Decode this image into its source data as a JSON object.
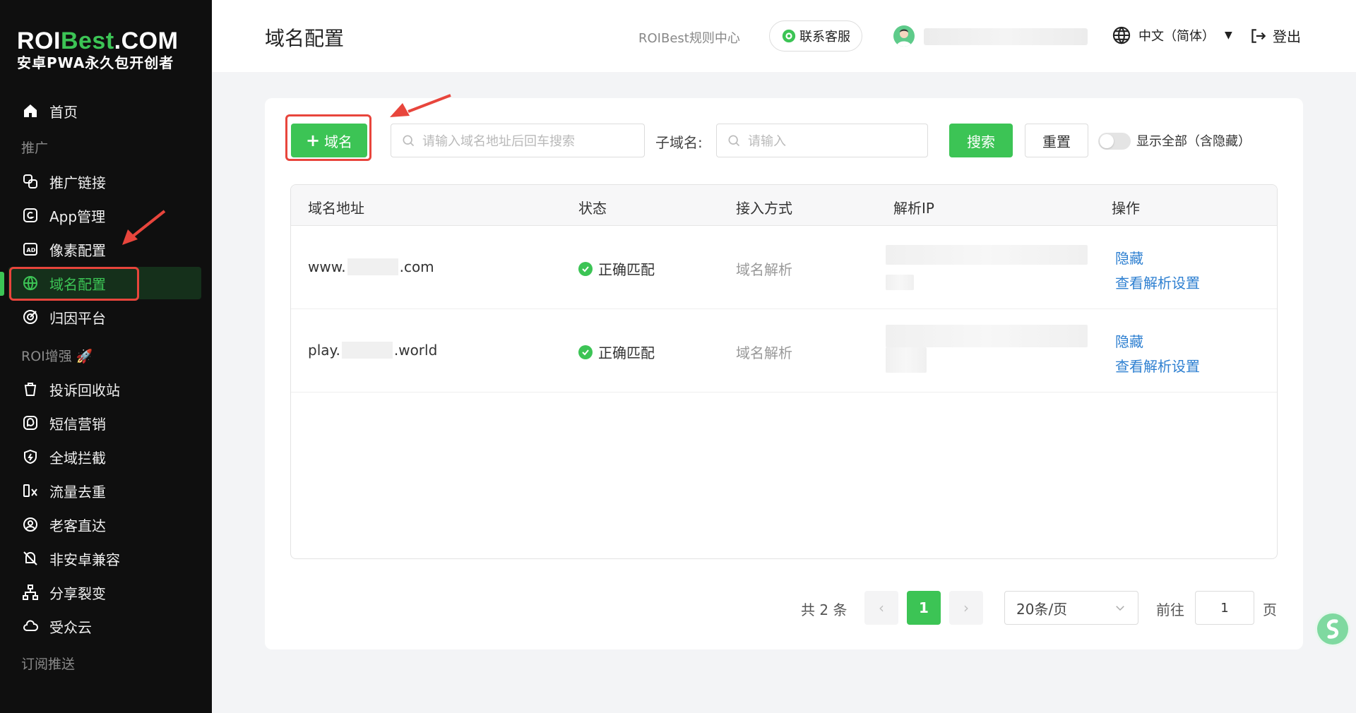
{
  "sidebar": {
    "logo_main_a": "ROI",
    "logo_main_b": "Best",
    "logo_main_c": ".COM",
    "logo_sub": "安卓PWA永久包开创者",
    "items": [
      {
        "label": "首页",
        "icon": "home-icon"
      },
      {
        "label": "推广链接",
        "icon": "link-icon"
      },
      {
        "label": "App管理",
        "icon": "app-icon"
      },
      {
        "label": "像素配置",
        "icon": "ad-icon"
      },
      {
        "label": "域名配置",
        "icon": "globe-icon",
        "active": true
      },
      {
        "label": "归因平台",
        "icon": "attribution-icon"
      },
      {
        "label": "投诉回收站",
        "icon": "trash-icon"
      },
      {
        "label": "短信营销",
        "icon": "sms-icon"
      },
      {
        "label": "全域拦截",
        "icon": "shield-icon"
      },
      {
        "label": "流量去重",
        "icon": "dedupe-icon"
      },
      {
        "label": "老客直达",
        "icon": "user-return-icon"
      },
      {
        "label": "非安卓兼容",
        "icon": "android-off-icon"
      },
      {
        "label": "分享裂变",
        "icon": "share-tree-icon"
      },
      {
        "label": "受众云",
        "icon": "cloud-icon"
      }
    ],
    "sections": {
      "promo": "推广",
      "roi": "ROI增强",
      "roi_emoji": "🚀",
      "subscribe": "订阅推送"
    }
  },
  "header": {
    "title": "域名配置",
    "rule_center": "ROIBest规则中心",
    "support": "联系客服",
    "language": "中文（简体）",
    "logout": "登出"
  },
  "toolbar": {
    "add_label": "域名",
    "search_placeholder": "请输入域名地址后回车搜索",
    "subdomain_label": "子域名:",
    "subdomain_placeholder": "请输入",
    "search_btn": "搜索",
    "reset_btn": "重置",
    "show_all_label": "显示全部（含隐藏）"
  },
  "table": {
    "headers": [
      "域名地址",
      "状态",
      "接入方式",
      "解析IP",
      "操作"
    ],
    "rows": [
      {
        "prefix": "www.",
        "suffix": ".com",
        "status": "正确匹配",
        "access": "域名解析",
        "hide": "隐藏",
        "view": "查看解析设置"
      },
      {
        "prefix": "play.",
        "suffix": ".world",
        "status": "正确匹配",
        "access": "域名解析",
        "hide": "隐藏",
        "view": "查看解析设置"
      }
    ]
  },
  "pagination": {
    "total": "共 2 条",
    "current": "1",
    "page_size": "20条/页",
    "goto": "前往",
    "goto_value": "1",
    "page_suffix": "页"
  },
  "colors": {
    "brand_green": "#3cc455",
    "sidebar_bg": "#0f0f0f",
    "link_blue": "#2f80d1",
    "highlight_red": "#e8453c"
  }
}
